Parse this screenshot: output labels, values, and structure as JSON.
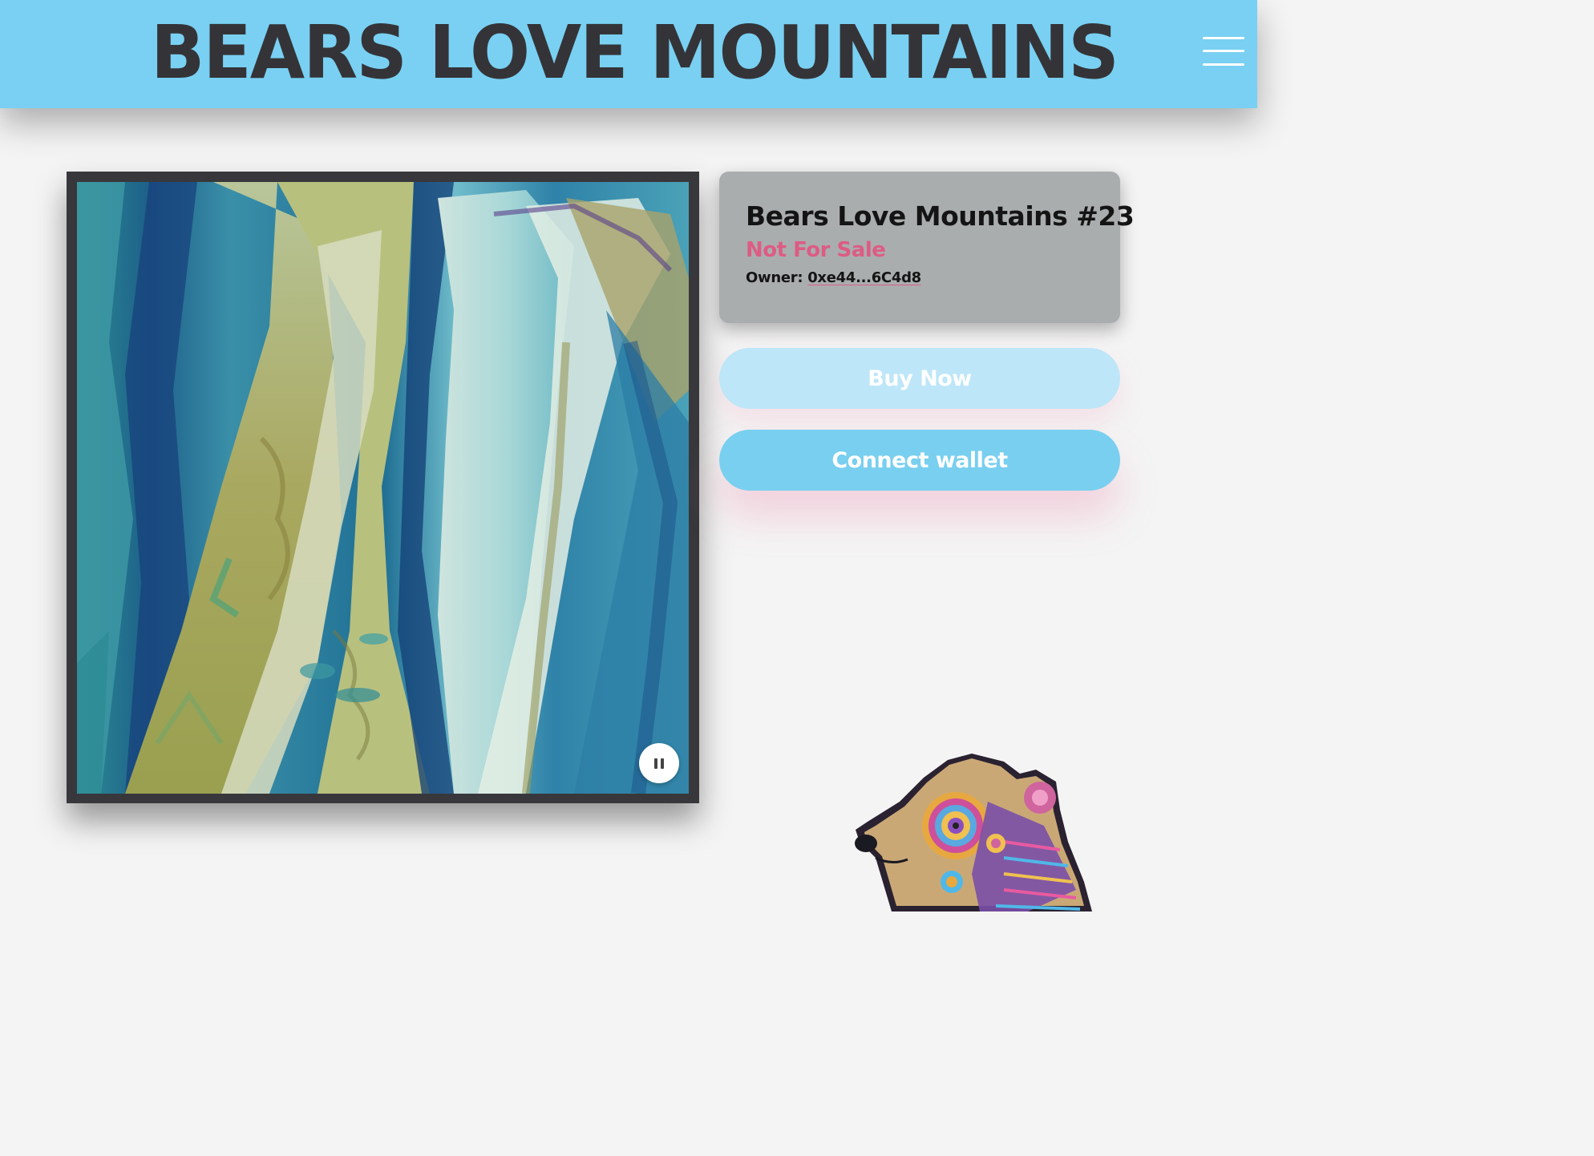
{
  "header": {
    "site_title": "BEARS LOVE MOUNTAINS"
  },
  "media": {
    "pause_label": "Pause"
  },
  "token": {
    "title": "Bears Love Mountains #23",
    "sale_status": "Not For Sale",
    "owner_label": "Owner:",
    "owner_address": "0xe44...6C4d8"
  },
  "actions": {
    "buy_label": "Buy Now",
    "connect_label": "Connect wallet"
  },
  "colors": {
    "header_bg": "#79d0f2",
    "title_text": "#343438",
    "status_pink": "#dd5c84",
    "card_bg": "#aaadae",
    "connect_bg": "#79cfef",
    "buy_bg_disabled": "#bde6f8"
  },
  "icons": {
    "menu": "hamburger-icon",
    "pause": "pause-icon",
    "mascot": "bear-mascot-illustration"
  }
}
